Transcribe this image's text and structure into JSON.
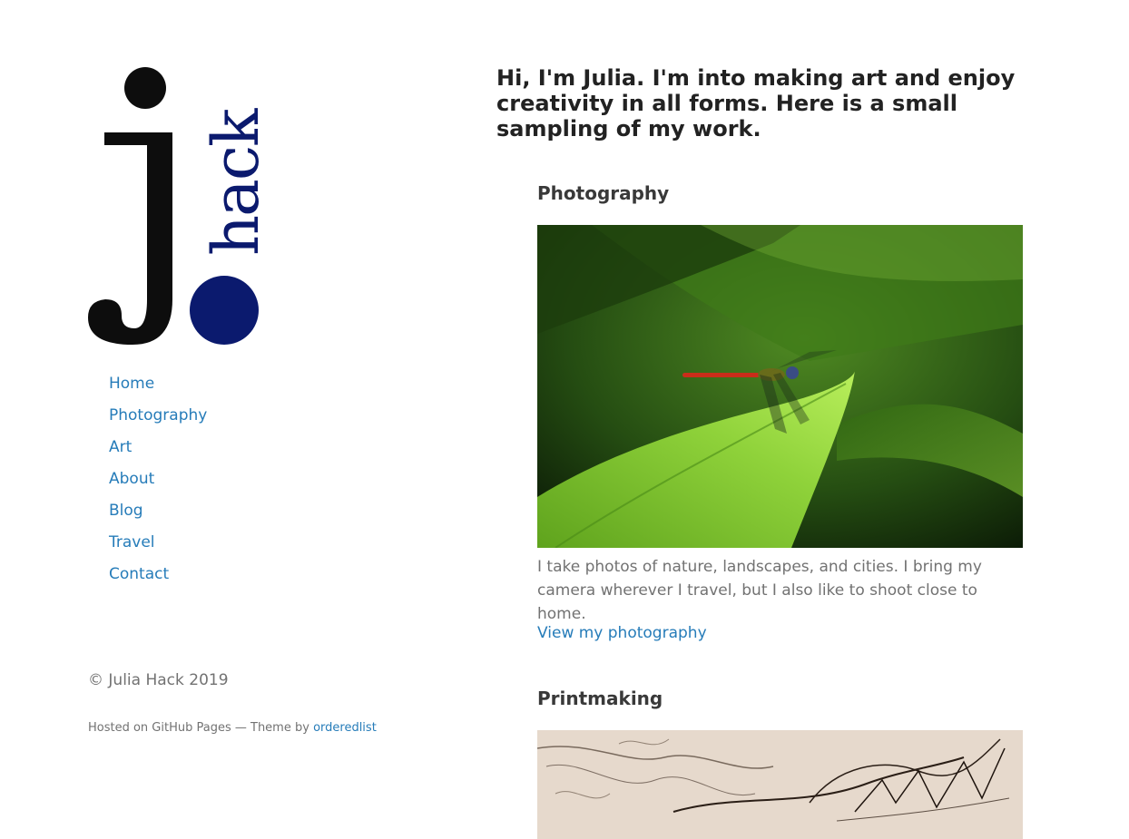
{
  "logo": {
    "letter": "j",
    "word": "hack",
    "colors": {
      "letter": "#0d0d0d",
      "accent": "#0b1a6e"
    }
  },
  "nav": {
    "items": [
      "Home",
      "Photography",
      "Art",
      "About",
      "Blog",
      "Travel",
      "Contact"
    ]
  },
  "footer": {
    "copyright": "© Julia Hack 2019",
    "hosted_prefix": "Hosted on GitHub Pages — Theme by ",
    "theme_link": "orderedlist"
  },
  "intro": "Hi, I'm Julia. I'm into making art and enjoy creativity in all forms. Here is a small sampling of my work.",
  "sections": {
    "photography": {
      "title": "Photography",
      "image": "dragonfly-on-leaf photo",
      "description": "I take photos of nature, landscapes, and cities. I bring my camera wherever I travel, but I also like to shoot close to home.",
      "link": "View my photography"
    },
    "printmaking": {
      "title": "Printmaking",
      "image": "shell-etching print"
    }
  },
  "colors": {
    "link": "#267cb9",
    "heading": "#222222",
    "text": "#727272"
  }
}
